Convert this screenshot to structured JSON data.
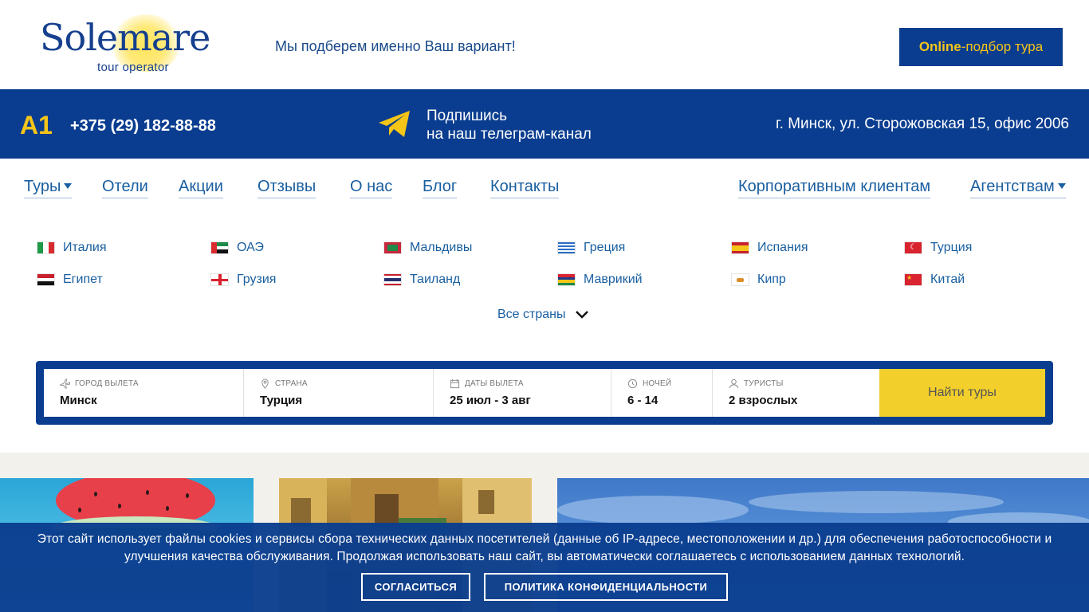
{
  "header": {
    "logo_brand": "Solemare",
    "logo_sub": "tour operator",
    "tagline": "Мы подберем именно Ваш вариант!",
    "online_btn_bold": "Online",
    "online_btn_rest": "-подбор тура"
  },
  "band": {
    "operator": "A1",
    "phone": "+375 (29) 182-88-88",
    "telegram_line1": "Подпишись",
    "telegram_line2": "на наш телеграм-канал",
    "address": "г. Минск, ул. Сторожовская 15, офис 2006"
  },
  "nav": {
    "items": [
      "Туры",
      "Отели",
      "Акции",
      "Отзывы",
      "О нас",
      "Блог",
      "Контакты"
    ],
    "right_items": [
      "Корпоративным клиентам",
      "Агентствам"
    ]
  },
  "countries": {
    "items": [
      "Италия",
      "ОАЭ",
      "Мальдивы",
      "Греция",
      "Испания",
      "Турция",
      "Египет",
      "Грузия",
      "Таиланд",
      "Маврикий",
      "Кипр",
      "Китай"
    ],
    "all_label": "Все страны"
  },
  "search": {
    "departure_label": "Город вылета",
    "departure_value": "Минск",
    "country_label": "Страна",
    "country_value": "Турция",
    "dates_label": "Даты вылета",
    "dates_value": "25 июл - 3 авг",
    "nights_label": "Ночей",
    "nights_value": "6 - 14",
    "tourists_label": "Туристы",
    "tourists_value": "2 взрослых",
    "find_button": "Найти туры"
  },
  "cookie": {
    "message": "Этот сайт использует файлы cookies и сервисы сбора технических данных посетителей (данные об IP-адресе, местоположении и др.) для обеспечения работоспособности и улучшения качества обслуживания. Продолжая использовать наш сайт, вы автоматически соглашаетесь с использованием данных технологий.",
    "agree_button": "Согласиться",
    "policy_button": "Политика конфиденциальности"
  },
  "colors": {
    "brand_blue": "#0a3d8f",
    "accent_yellow": "#f5c518",
    "button_yellow": "#f2cf2a",
    "link_blue": "#1a5fa0"
  }
}
